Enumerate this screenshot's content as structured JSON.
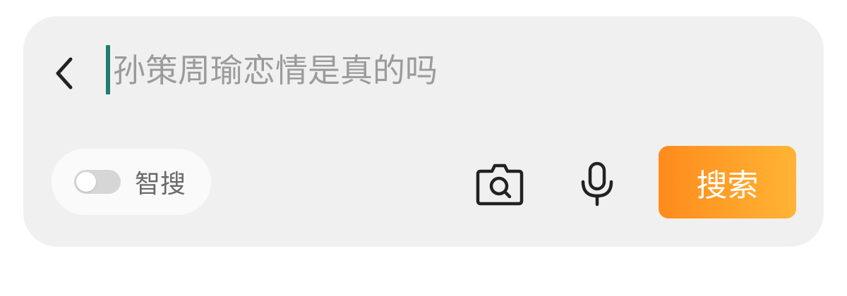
{
  "search": {
    "placeholder": "孙策周瑜恋情是真的吗",
    "value": ""
  },
  "smart_search": {
    "label": "智搜",
    "enabled": false
  },
  "actions": {
    "camera_icon": "camera-search-icon",
    "mic_icon": "microphone-icon",
    "search_label": "搜索"
  },
  "colors": {
    "card_background": "#f0f0f0",
    "caret": "#1f7e6f",
    "search_button_start": "#ff8b1c",
    "search_button_end": "#ffb435",
    "placeholder": "#9b9b9b"
  }
}
